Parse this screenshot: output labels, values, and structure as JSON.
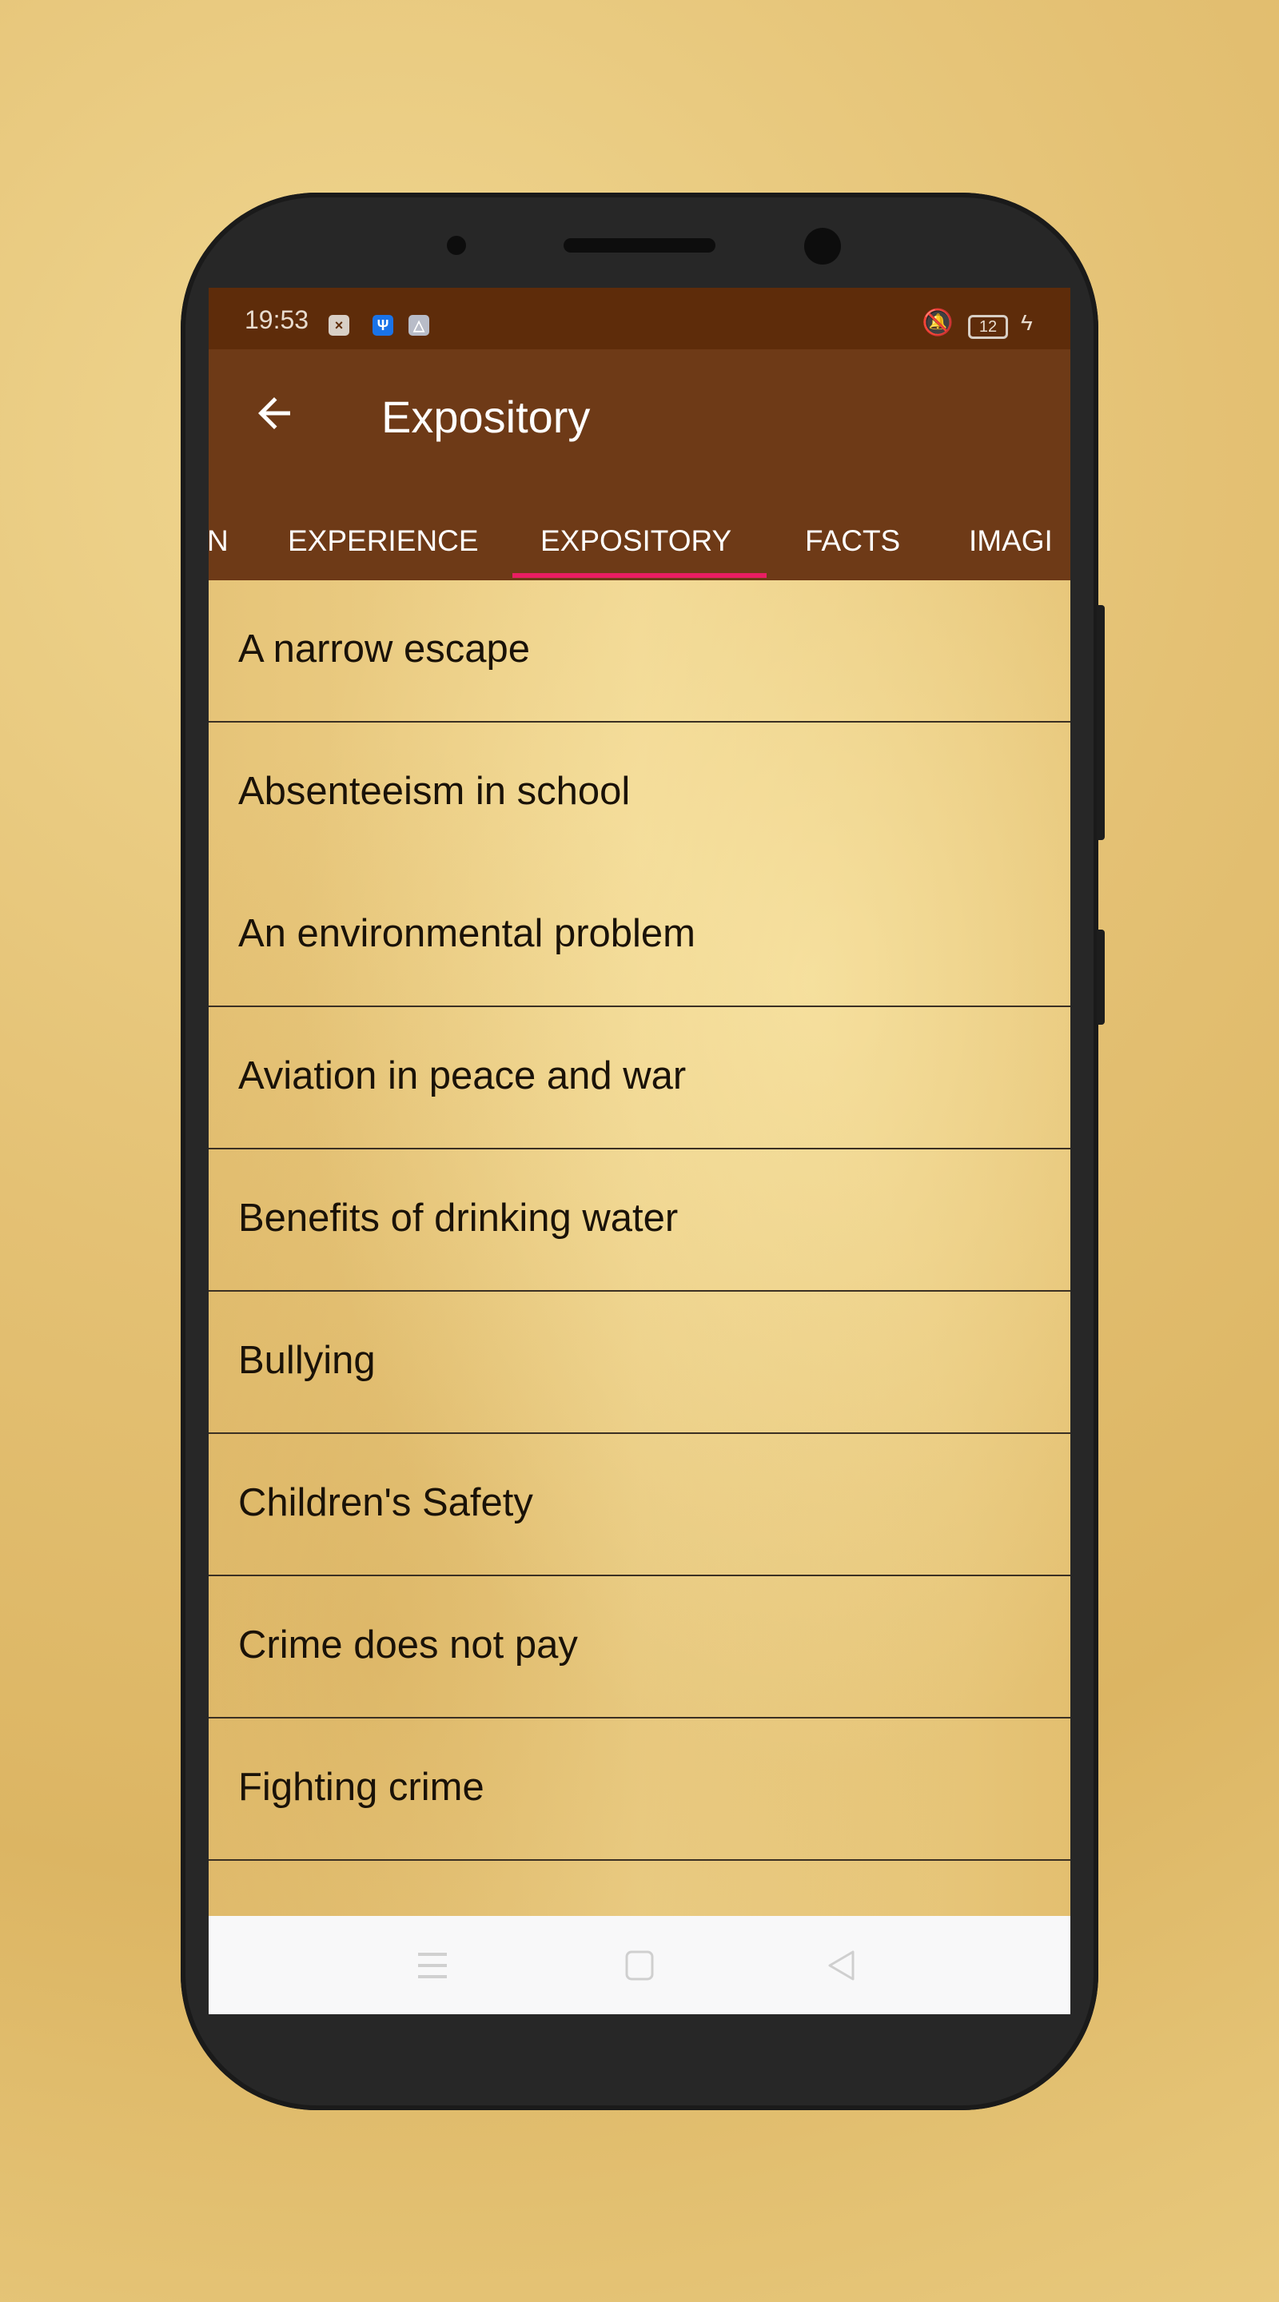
{
  "status_bar": {
    "time": "19:53",
    "battery": "12",
    "icons": [
      "sim-error-icon",
      "usb-icon",
      "network-share-icon",
      "vibrate-silent-icon",
      "battery-icon",
      "charging-icon"
    ]
  },
  "app_bar": {
    "title": "Expository",
    "back_icon": "arrow-left-icon"
  },
  "tabs": [
    {
      "label": "N"
    },
    {
      "label": "EXPERIENCE"
    },
    {
      "label": "EXPOSITORY",
      "selected": true
    },
    {
      "label": "FACTS"
    },
    {
      "label": "IMAGI"
    }
  ],
  "list": {
    "items": [
      "A narrow escape",
      "Absenteeism in school",
      "An environmental problem",
      "Aviation in peace and war",
      "Benefits of drinking water",
      "Bullying",
      "Children's Safety",
      "Crime does not pay",
      "Fighting crime"
    ]
  },
  "nav_bar": {
    "icons": [
      "menu-icon",
      "home-icon",
      "back-triangle-icon"
    ]
  },
  "colors": {
    "status_bar": "#5e2c0a",
    "app_bar": "#6e3a17",
    "indicator": "#e91e63"
  }
}
